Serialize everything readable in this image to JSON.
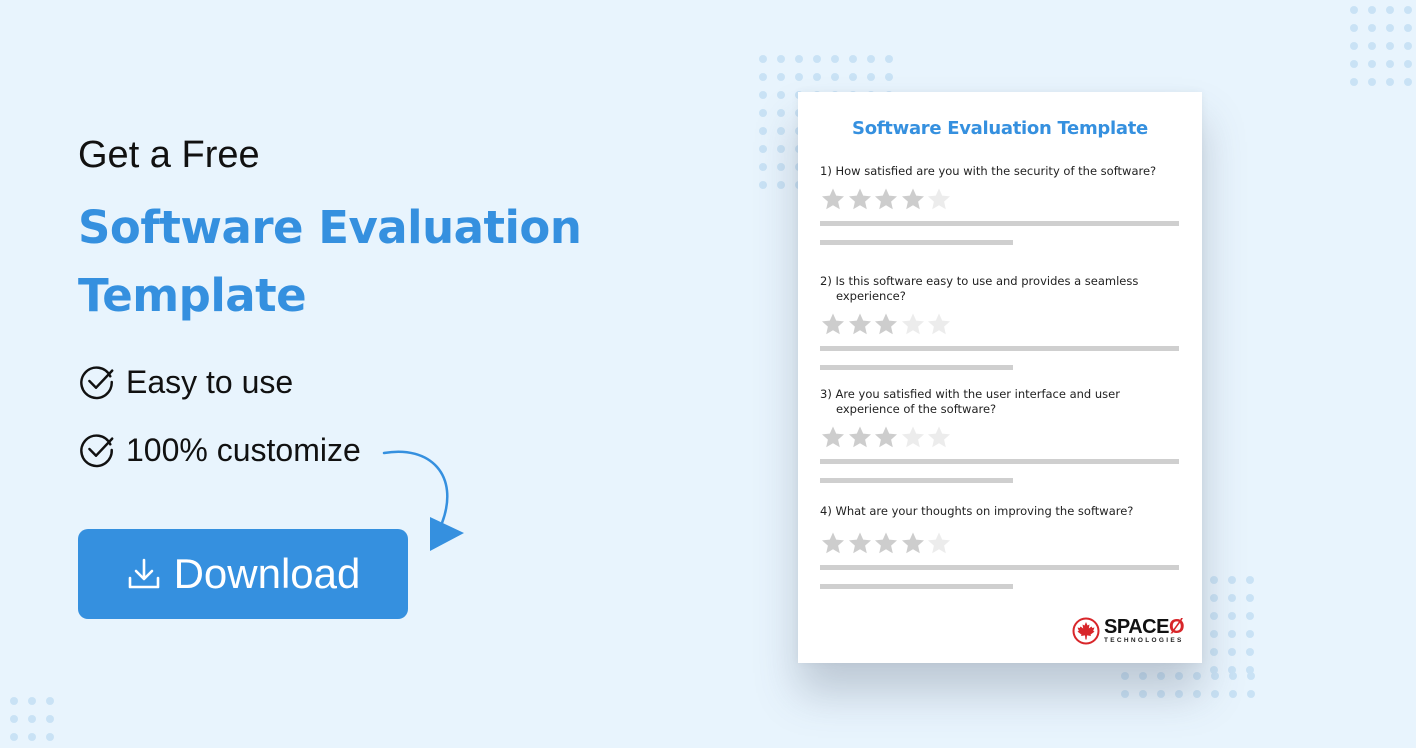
{
  "hero": {
    "kicker": "Get a Free",
    "headline_line1": "Software Evaluation",
    "headline_line2": "Template"
  },
  "features": [
    {
      "icon": "check-circle-icon",
      "label": "Easy to use"
    },
    {
      "icon": "check-circle-icon",
      "label": "100% customize"
    }
  ],
  "download": {
    "icon": "download-icon",
    "label": "Download"
  },
  "document": {
    "title": "Software Evaluation Template",
    "questions": [
      {
        "text": "1) How satisfied are you with the security of the software?",
        "rating": 4,
        "max": 5
      },
      {
        "text": "2) Is this software easy to use and provides a seamless experience?",
        "rating": 3,
        "max": 5
      },
      {
        "text": "3) Are you satisfied with the user interface and user experience of the software?",
        "rating": 3,
        "max": 5
      },
      {
        "text": "4) What are your thoughts on improving the software?",
        "rating": 4,
        "max": 5
      }
    ],
    "logo": {
      "main_prefix": "SPACE",
      "main_suffix": "Ø",
      "sub": "TECHNOLOGIES"
    }
  },
  "colors": {
    "accent": "#3590df",
    "background": "#e8f4fd",
    "star_filled": "#cdcdcd",
    "star_empty": "#ececec",
    "logo_red": "#d8262a"
  }
}
